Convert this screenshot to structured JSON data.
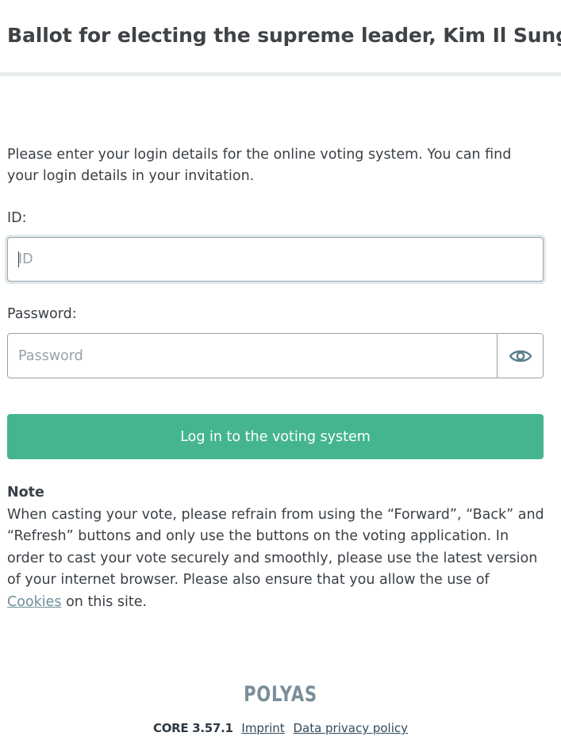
{
  "header": {
    "title": "Ballot for electing the supreme leader, Kim Il Sung"
  },
  "intro": {
    "text": "Please enter your login details for the online voting system. You can find your login details in your invitation."
  },
  "form": {
    "id_label": "ID:",
    "id_placeholder": "ID",
    "id_value": "",
    "password_label": "Password:",
    "password_placeholder": "Password",
    "password_value": "",
    "toggle_icon": "eye-icon",
    "login_label": "Log in to the voting system"
  },
  "note": {
    "title": "Note",
    "text_before_link": "When casting your vote, please refrain from using the “Forward”, “Back” and “Refresh” buttons and only use the buttons on the voting application. In order to cast your vote securely and smoothly, please use the latest version of your internet browser. Please also ensure that you allow the use of ",
    "link_label": "Cookies",
    "text_after_link": " on this site."
  },
  "footer": {
    "logo": "POLYAS",
    "version": "CORE 3.57.1",
    "imprint_label": "Imprint",
    "privacy_label": "Data privacy policy"
  },
  "colors": {
    "accent": "#45b590",
    "link": "#6f8e99",
    "logo": "#7a8e99"
  }
}
